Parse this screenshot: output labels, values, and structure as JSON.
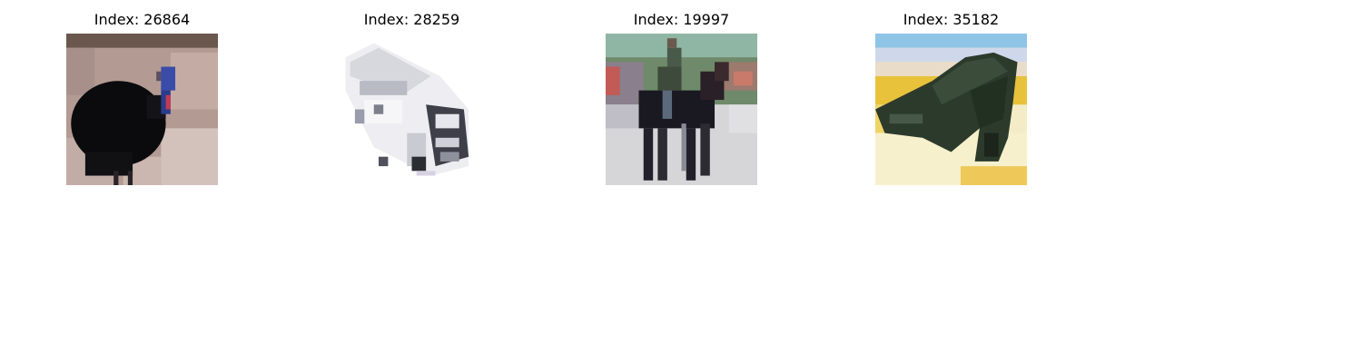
{
  "panels": [
    {
      "title": "Index: 26864",
      "subject": "bird"
    },
    {
      "title": "Index: 28259",
      "subject": "truck"
    },
    {
      "title": "Index: 19997",
      "subject": "horse and rider"
    },
    {
      "title": "Index: 35182",
      "subject": "airplane"
    }
  ]
}
